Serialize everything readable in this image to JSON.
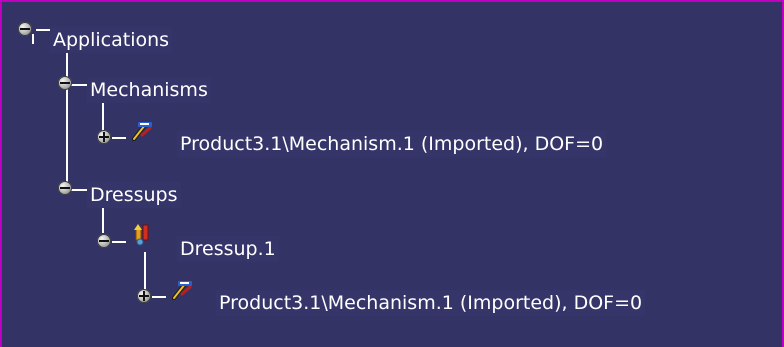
{
  "tree": {
    "root": {
      "label": "Applications",
      "state": "expanded"
    },
    "mechanisms": {
      "label": "Mechanisms",
      "state": "expanded"
    },
    "mechanism_item": {
      "label": "Product3.1\\Mechanism.1 (Imported), DOF=0",
      "state": "collapsed",
      "icon": "mechanism-icon"
    },
    "dressups": {
      "label": "Dressups",
      "state": "expanded"
    },
    "dressup_item": {
      "label": "Dressup.1",
      "state": "expanded",
      "icon": "dressup-icon"
    },
    "dressup_child": {
      "label": "Product3.1\\Mechanism.1 (Imported), DOF=0",
      "state": "collapsed",
      "icon": "mechanism-icon"
    }
  },
  "colors": {
    "background": "#333366",
    "text": "#ffffff",
    "frame": "#c000c0"
  }
}
